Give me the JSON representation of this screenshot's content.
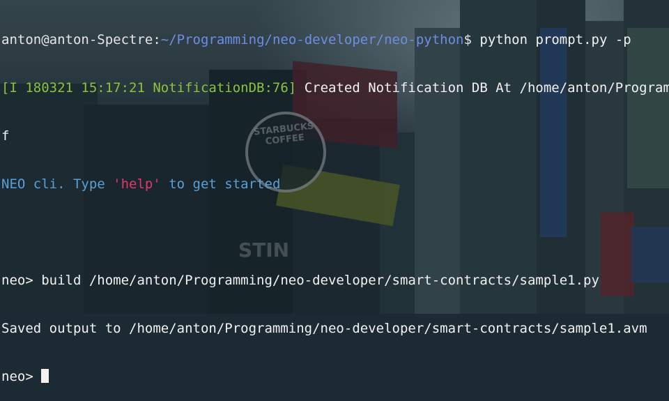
{
  "terminal": {
    "prompt": {
      "user_host": "anton@anton-Spectre",
      "separator": ":",
      "path": "~/Programming/neo-developer/neo-python",
      "symbol": "$",
      "command": " python prompt.py -p"
    },
    "log_line": {
      "prefix": "[I 180321 15:17:21 NotificationDB:76]",
      "message": " Created Notification DB At /home/anton/Program",
      "wrap": "f"
    },
    "welcome": {
      "part1": "NEO cli. Type ",
      "help": "'help'",
      "part2": " to get started"
    },
    "build_line": "neo> build /home/anton/Programming/neo-developer/smart-contracts/sample1.py",
    "saved_line": "Saved output to /home/anton/Programming/neo-developer/smart-contracts/sample1.avm",
    "active_prompt": "neo> "
  },
  "background": {
    "starbucks_sign": "STARBUCKS COFFEE",
    "theater_sign": "STIN"
  },
  "colors": {
    "prompt_path": "#6d8ee6",
    "log_text": "#8cc43d",
    "neo_cli_text": "#5aa0d6",
    "help_keyword": "#e03a6a"
  }
}
